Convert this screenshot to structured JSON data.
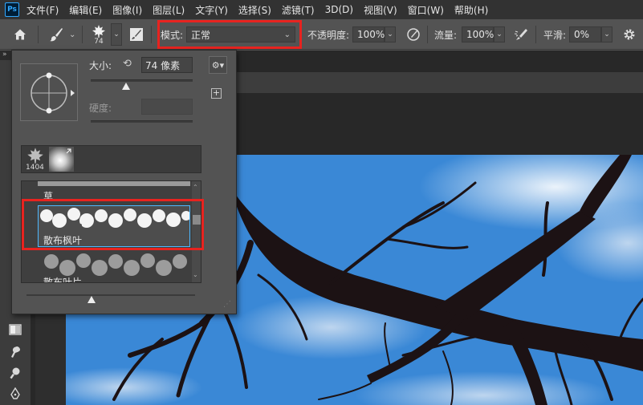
{
  "app": {
    "logo": "Ps"
  },
  "menu": [
    "文件(F)",
    "编辑(E)",
    "图像(I)",
    "图层(L)",
    "文字(Y)",
    "选择(S)",
    "滤镜(T)",
    "3D(D)",
    "视图(V)",
    "窗口(W)",
    "帮助(H)"
  ],
  "options_bar": {
    "brush_size": "74",
    "mode_label": "模式:",
    "mode_value": "正常",
    "opacity_label": "不透明度:",
    "opacity_value": "100%",
    "flow_label": "流量:",
    "flow_value": "100%",
    "smoothing_label": "平滑:",
    "smoothing_value": "0%"
  },
  "brush_panel": {
    "size_label": "大小:",
    "size_value": "74 像素",
    "hardness_label": "硬度:",
    "size_slider_fraction": 0.35,
    "recent_brush_count": "1404",
    "brushes": [
      {
        "name": "草"
      },
      {
        "name": "散布枫叶",
        "selected": true
      },
      {
        "name": "散布叶片"
      }
    ]
  },
  "colors": {
    "highlight_red": "#e8231f",
    "selection_blue": "#4db8ff",
    "sky_blue": "#2c7bd0",
    "branch": "#1c1214"
  }
}
